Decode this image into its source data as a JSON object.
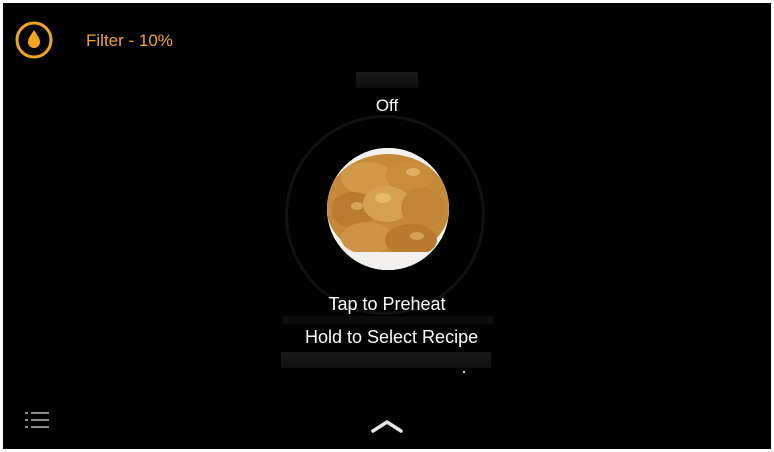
{
  "status": {
    "filter_label": "Filter - 10%",
    "filter_icon": "droplet-icon"
  },
  "main": {
    "state": "Off",
    "tap_hint": "Tap to Preheat",
    "hold_hint": "Hold to Select Recipe",
    "food_image": "chicken-nuggets"
  },
  "footer": {
    "menu_icon": "list-menu-icon",
    "expand_icon": "chevron-up-icon"
  },
  "colors": {
    "accent": "#f2a61e",
    "background": "#000000",
    "text": "#ffffff"
  }
}
